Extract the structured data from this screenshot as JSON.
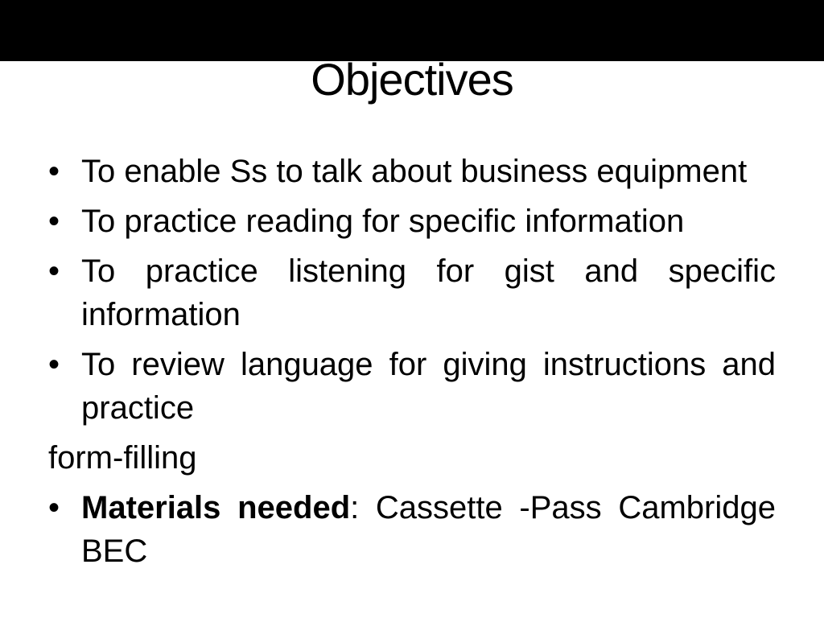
{
  "slide": {
    "title": "Objectives",
    "bullets": [
      {
        "symbol": "•",
        "text": "To enable Ss to talk about business equipment"
      },
      {
        "symbol": "•",
        "text": " To practice reading for specific information"
      },
      {
        "symbol": "•",
        "text": " To practice listening for gist and specific information"
      },
      {
        "symbol": "•",
        "text": " To review language for giving instructions and practice"
      }
    ],
    "continuation": "form-filling",
    "materials": {
      "symbol": "•",
      "label": "Materials needed",
      "separator": ":",
      "text": " Cassette -Pass Cambridge BEC"
    }
  }
}
